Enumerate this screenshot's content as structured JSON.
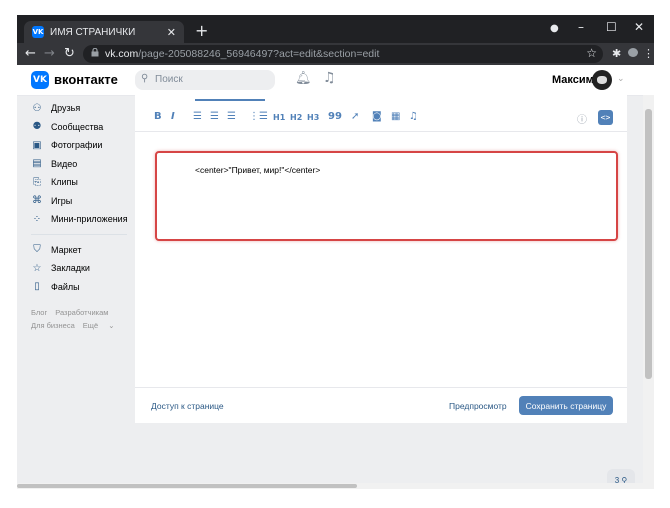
{
  "browser": {
    "tab_title": "ИМЯ СТРАНИЧКИ",
    "tab_favicon": "VK",
    "url_host": "vk.com",
    "url_path": "/page-205088246_56946497?act=edit&section=edit"
  },
  "header": {
    "logo_text": "вконтакте",
    "logo_mark": "VK",
    "search_placeholder": "Поиск",
    "user_name": "Максим"
  },
  "sidebar": {
    "items": [
      {
        "label": "Друзья",
        "icon": "friends-icon"
      },
      {
        "label": "Сообщества",
        "icon": "communities-icon"
      },
      {
        "label": "Фотографии",
        "icon": "photos-icon"
      },
      {
        "label": "Видео",
        "icon": "video-icon"
      },
      {
        "label": "Клипы",
        "icon": "clips-icon"
      },
      {
        "label": "Игры",
        "icon": "games-icon"
      },
      {
        "label": "Мини-приложения",
        "icon": "mini-apps-icon"
      }
    ],
    "items2": [
      {
        "label": "Маркет",
        "icon": "market-icon"
      },
      {
        "label": "Закладки",
        "icon": "bookmarks-icon"
      },
      {
        "label": "Файлы",
        "icon": "files-icon"
      }
    ],
    "footer": {
      "blog": "Блог",
      "developers": "Разработчикам",
      "business": "Для бизнеса",
      "more": "Ещё"
    }
  },
  "editor": {
    "toolbar": {
      "bold": "B",
      "italic": "I",
      "h1": "H1",
      "h2": "H2",
      "h3": "H3",
      "quote": "99"
    },
    "code_content": "<center>\"Привет, мир!\"</center>",
    "access_link": "Доступ к странице",
    "preview_link": "Предпросмотр",
    "save_button": "Сохранить страницу"
  },
  "chat_widget": "3"
}
